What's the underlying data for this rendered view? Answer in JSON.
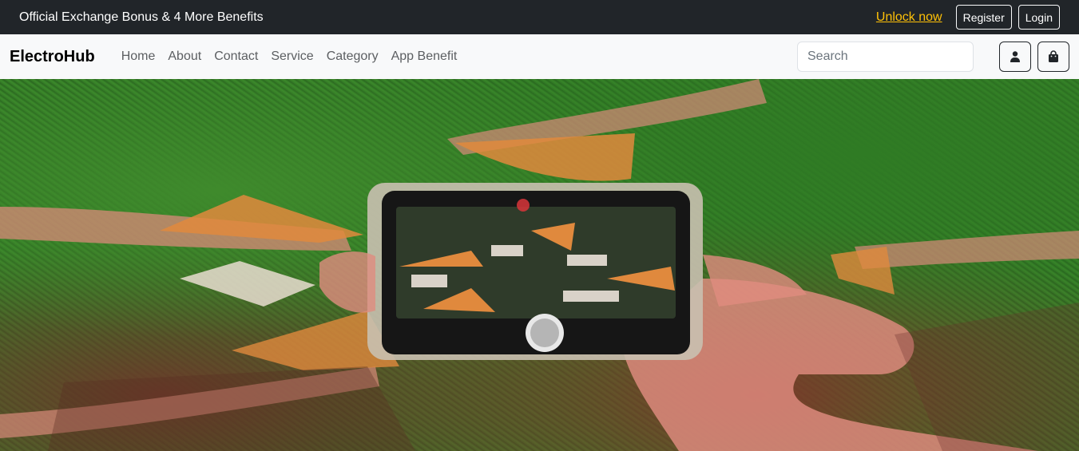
{
  "topbar": {
    "promo": "Official Exchange Bonus & 4 More Benefits",
    "unlock": "Unlock now",
    "register": "Register",
    "login": "Login"
  },
  "navbar": {
    "brand": "ElectroHub",
    "links": [
      "Home",
      "About",
      "Contact",
      "Service",
      "Category",
      "App Benefit"
    ],
    "search_placeholder": "Search",
    "user_icon": "user-icon",
    "cart_icon": "shopping-bag-icon"
  },
  "hero": {
    "image": "hands holding a phone photographing pizza slices and photos on grass"
  },
  "colors": {
    "topbar_bg": "#212529",
    "navbar_bg": "#f8f9fa",
    "accent": "#ffc107"
  }
}
